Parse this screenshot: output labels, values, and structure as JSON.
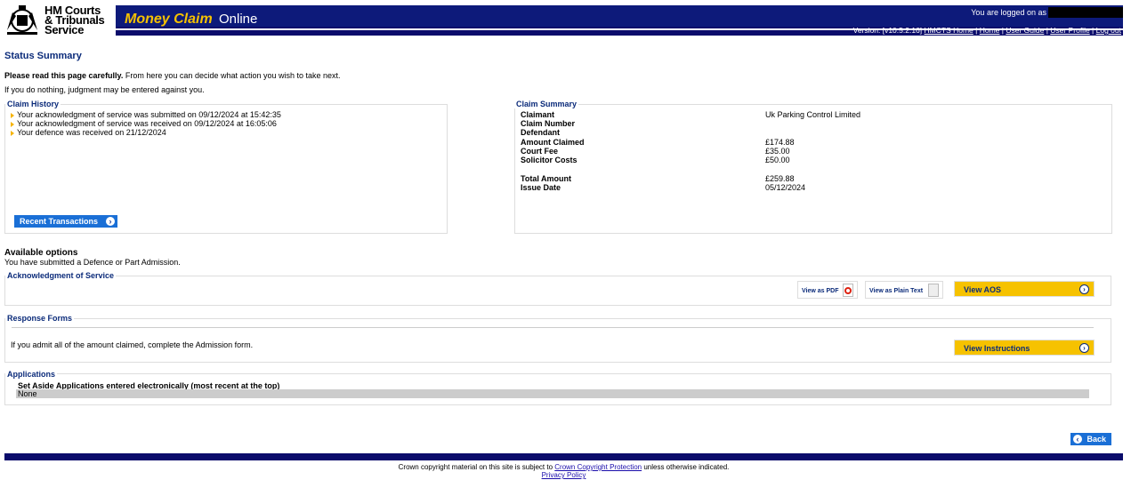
{
  "header": {
    "logo_lines": [
      "HM Courts",
      "& Tribunals",
      "Service"
    ],
    "app_name": "Money Claim",
    "app_name_suffix": "Online",
    "logged_in_text": "You are logged on as",
    "version_text": "Version: [v10.5.2.16]",
    "links": [
      "HMCTS Home",
      "Home",
      "User Guide",
      "User Profile",
      "Log out"
    ]
  },
  "page": {
    "title": "Status Summary",
    "intro_bold": "Please read this page carefully.",
    "intro_rest": " From here you can decide what action you wish to take next.",
    "intro_2": "If you do nothing, judgment may be entered against you."
  },
  "history": {
    "legend": "Claim History",
    "items": [
      "Your acknowledgment of service was submitted on 09/12/2024 at 15:42:35",
      "Your acknowledgment of service was received on 09/12/2024 at 16:05:06",
      "Your defence was received on 21/12/2024"
    ],
    "button": "Recent Transactions"
  },
  "summary": {
    "legend": "Claim Summary",
    "rows": [
      {
        "label": "Claimant",
        "value": "Uk Parking Control Limited"
      },
      {
        "label": "Claim Number",
        "value": ""
      },
      {
        "label": "Defendant",
        "value": ""
      },
      {
        "label": "Amount Claimed",
        "value": "£174.88"
      },
      {
        "label": "Court Fee",
        "value": "£35.00"
      },
      {
        "label": "Solicitor Costs",
        "value": "£50.00"
      },
      {
        "label": "Total Amount",
        "value": "£259.88"
      },
      {
        "label": "Issue Date",
        "value": "05/12/2024"
      }
    ]
  },
  "options": {
    "title": "Available options",
    "subtitle": "You have submitted a Defence or Part Admission."
  },
  "aos": {
    "legend": "Acknowledgment of Service",
    "pdf_label": "View as PDF",
    "text_label": "View as Plain Text",
    "view_button": "View AOS"
  },
  "response": {
    "legend": "Response Forms",
    "text": "If you admit all of the amount claimed, complete the Admission form.",
    "button": "View Instructions"
  },
  "applications": {
    "legend": "Applications",
    "heading": "Set Aside Applications entered electronically (most recent at the top)",
    "row": "None"
  },
  "back_button": "Back",
  "footer": {
    "text_before": "Crown copyright material on this site is subject to ",
    "link": "Crown Copyright Protection",
    "text_after": " unless otherwise indicated.",
    "privacy": "Privacy Policy"
  },
  "colors": {
    "navy": "#0b0c6b",
    "accent_yellow": "#f6c200",
    "button_blue": "#1a6fd6",
    "heading_blue": "#0b2b7a"
  }
}
